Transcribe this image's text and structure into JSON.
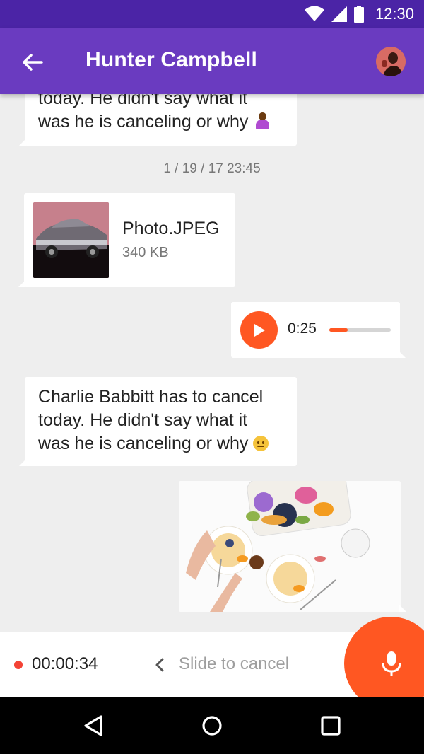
{
  "status_bar": {
    "time": "12:30"
  },
  "app_bar": {
    "title": "Hunter Campbell"
  },
  "messages": [
    {
      "type": "text",
      "direction": "incoming",
      "lines": [
        "today. He didn't say what it",
        "was he is canceling or why"
      ],
      "emoji": "person-gesturing-emoji"
    },
    {
      "type": "timestamp",
      "text": "1 / 19 / 17 23:45"
    },
    {
      "type": "file",
      "direction": "incoming",
      "name": "Photo.JPEG",
      "size": "340 KB"
    },
    {
      "type": "audio",
      "direction": "outgoing",
      "duration": "0:25",
      "progress": 0.3
    },
    {
      "type": "text",
      "direction": "incoming",
      "lines": [
        "Charlie Babbitt has to cancel",
        "today. He didn't say what it",
        "was he is canceling or why"
      ],
      "emoji": "worried-face-emoji"
    },
    {
      "type": "image",
      "direction": "outgoing"
    }
  ],
  "recorder": {
    "elapsed": "00:00:34",
    "hint": "Slide to cancel"
  },
  "colors": {
    "status_bar": "#4b24a6",
    "app_bar": "#6a3bc0",
    "accent": "#ff5722",
    "recording_dot": "#f44336",
    "background": "#eeeeee"
  }
}
